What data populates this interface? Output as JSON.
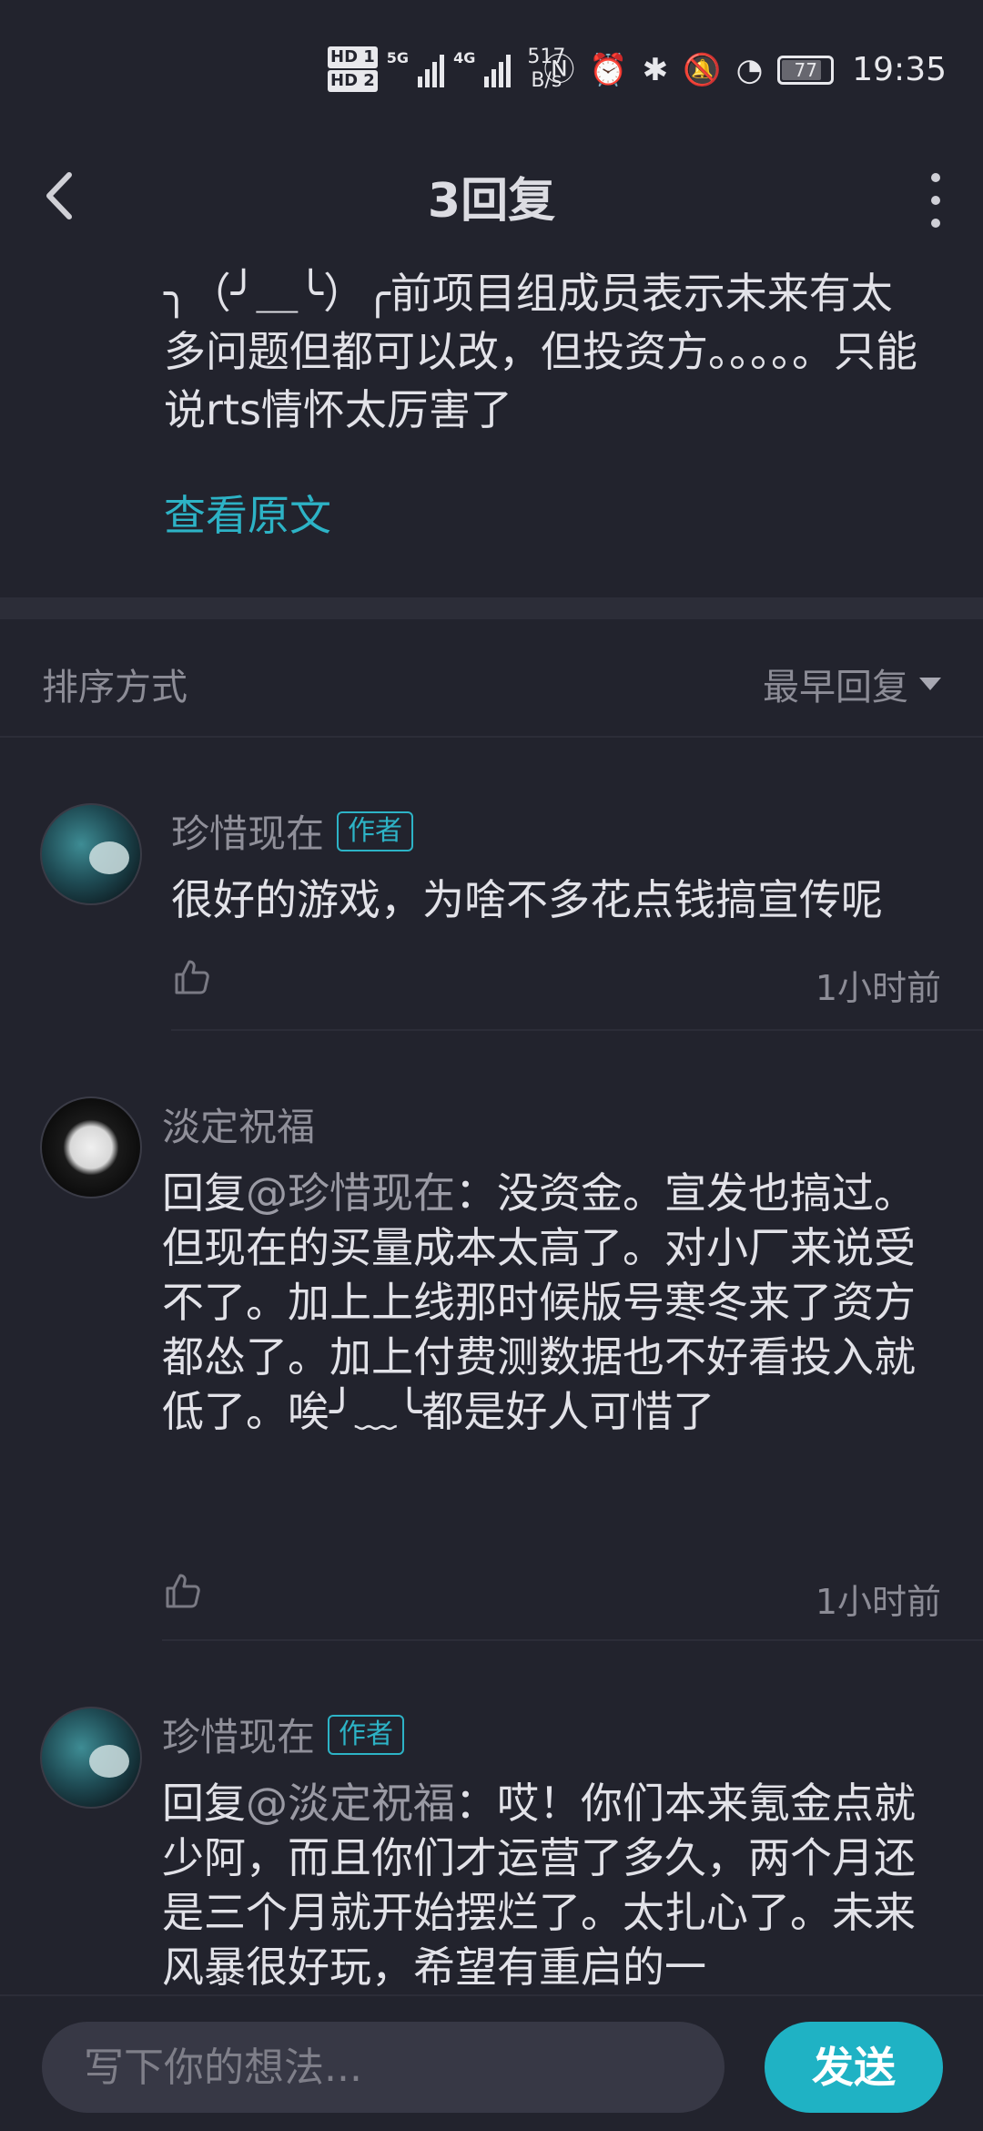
{
  "status_bar": {
    "hd1": "HD 1",
    "hd2": "HD 2",
    "net1": "5G",
    "net2": "4G",
    "speed_value": "517",
    "speed_unit": "B/s",
    "battery": "77",
    "time": "19:35",
    "icons": [
      "nfc-icon",
      "alarm-icon",
      "bluetooth-icon",
      "mute-bell-icon",
      "speedometer-icon",
      "battery-icon"
    ]
  },
  "header": {
    "title": "3回复"
  },
  "post": {
    "text": "╮（╯＿╰）╭前项目组成员表示未来有太多问题但都可以改，但投资方。。。。。只能说rts情怀太厉害了",
    "view_original": "查看原文"
  },
  "sort": {
    "label": "排序方式",
    "selected": "最早回复"
  },
  "comments": [
    {
      "name": "珍惜现在",
      "badge": "作者",
      "body": "很好的游戏，为啥不多花点钱搞宣传呢",
      "time": "1小时前"
    },
    {
      "name": "淡定祝福",
      "reply_prefix": "回复",
      "mention": "@珍惜现在",
      "body": "：没资金。宣发也搞过。但现在的买量成本太高了。对小厂来说受不了。加上上线那时候版号寒冬来了资方都怂了。加上付费测数据也不好看投入就低了。唉╯﹏╰都是好人可惜了",
      "time": "1小时前"
    },
    {
      "name": "珍惜现在",
      "badge": "作者",
      "reply_prefix": "回复",
      "mention": "@淡定祝福",
      "body": "：哎！你们本来氪金点就少阿，而且你们才运营了多久，两个月还是三个月就开始摆烂了。太扎心了。未来风暴很好玩，希望有重启的一"
    }
  ],
  "input": {
    "placeholder": "写下你的想法..."
  },
  "send_label": "发送",
  "colors": {
    "background": "#22232d",
    "accent": "#2db3c6",
    "send_button": "#1fb2c4"
  }
}
